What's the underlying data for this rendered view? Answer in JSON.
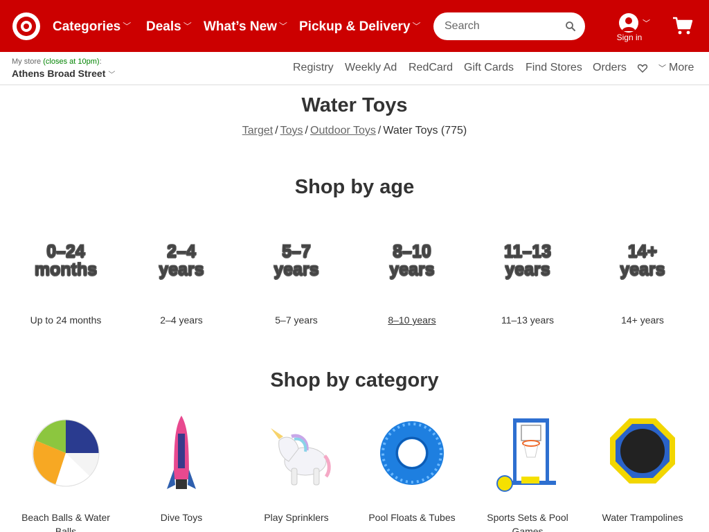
{
  "header": {
    "nav": [
      {
        "label": "Categories"
      },
      {
        "label": "Deals"
      },
      {
        "label": "What’s New"
      },
      {
        "label": "Pickup & Delivery"
      }
    ],
    "search_placeholder": "Search",
    "signin_label": "Sign in",
    "brand_color": "#cc0000"
  },
  "store": {
    "prefix": "My store",
    "status": "(closes at 10pm)",
    "suffix": ":",
    "name": "Athens Broad Street"
  },
  "utility_nav": [
    "Registry",
    "Weekly Ad",
    "RedCard",
    "Gift Cards",
    "Find Stores",
    "Orders"
  ],
  "more_label": "More",
  "page": {
    "title": "Water Toys",
    "breadcrumbs": [
      "Target",
      "Toys",
      "Outdoor Toys"
    ],
    "current": "Water Toys (775)"
  },
  "age_section": {
    "title": "Shop by age",
    "tiles": [
      {
        "line1": "0–24",
        "line2": "months",
        "label": "Up to 24 months"
      },
      {
        "line1": "2–4",
        "line2": "years",
        "label": "2–4 years"
      },
      {
        "line1": "5–7",
        "line2": "years",
        "label": "5–7 years"
      },
      {
        "line1": "8–10",
        "line2": "years",
        "label": "8–10 years"
      },
      {
        "line1": "11–13",
        "line2": "years",
        "label": "11–13 years"
      },
      {
        "line1": "14+",
        "line2": "years",
        "label": "14+ years"
      }
    ]
  },
  "category_section": {
    "title": "Shop by category",
    "tiles": [
      {
        "label": "Beach Balls & Water Balls",
        "icon": "beach-ball-image"
      },
      {
        "label": "Dive Toys",
        "icon": "dive-rocket-image"
      },
      {
        "label": "Play Sprinklers",
        "icon": "unicorn-sprinkler-image"
      },
      {
        "label": "Pool Floats & Tubes",
        "icon": "pool-tube-image"
      },
      {
        "label": "Sports Sets & Pool Games",
        "icon": "basketball-set-image"
      },
      {
        "label": "Water Trampolines",
        "icon": "water-trampoline-image"
      }
    ]
  }
}
